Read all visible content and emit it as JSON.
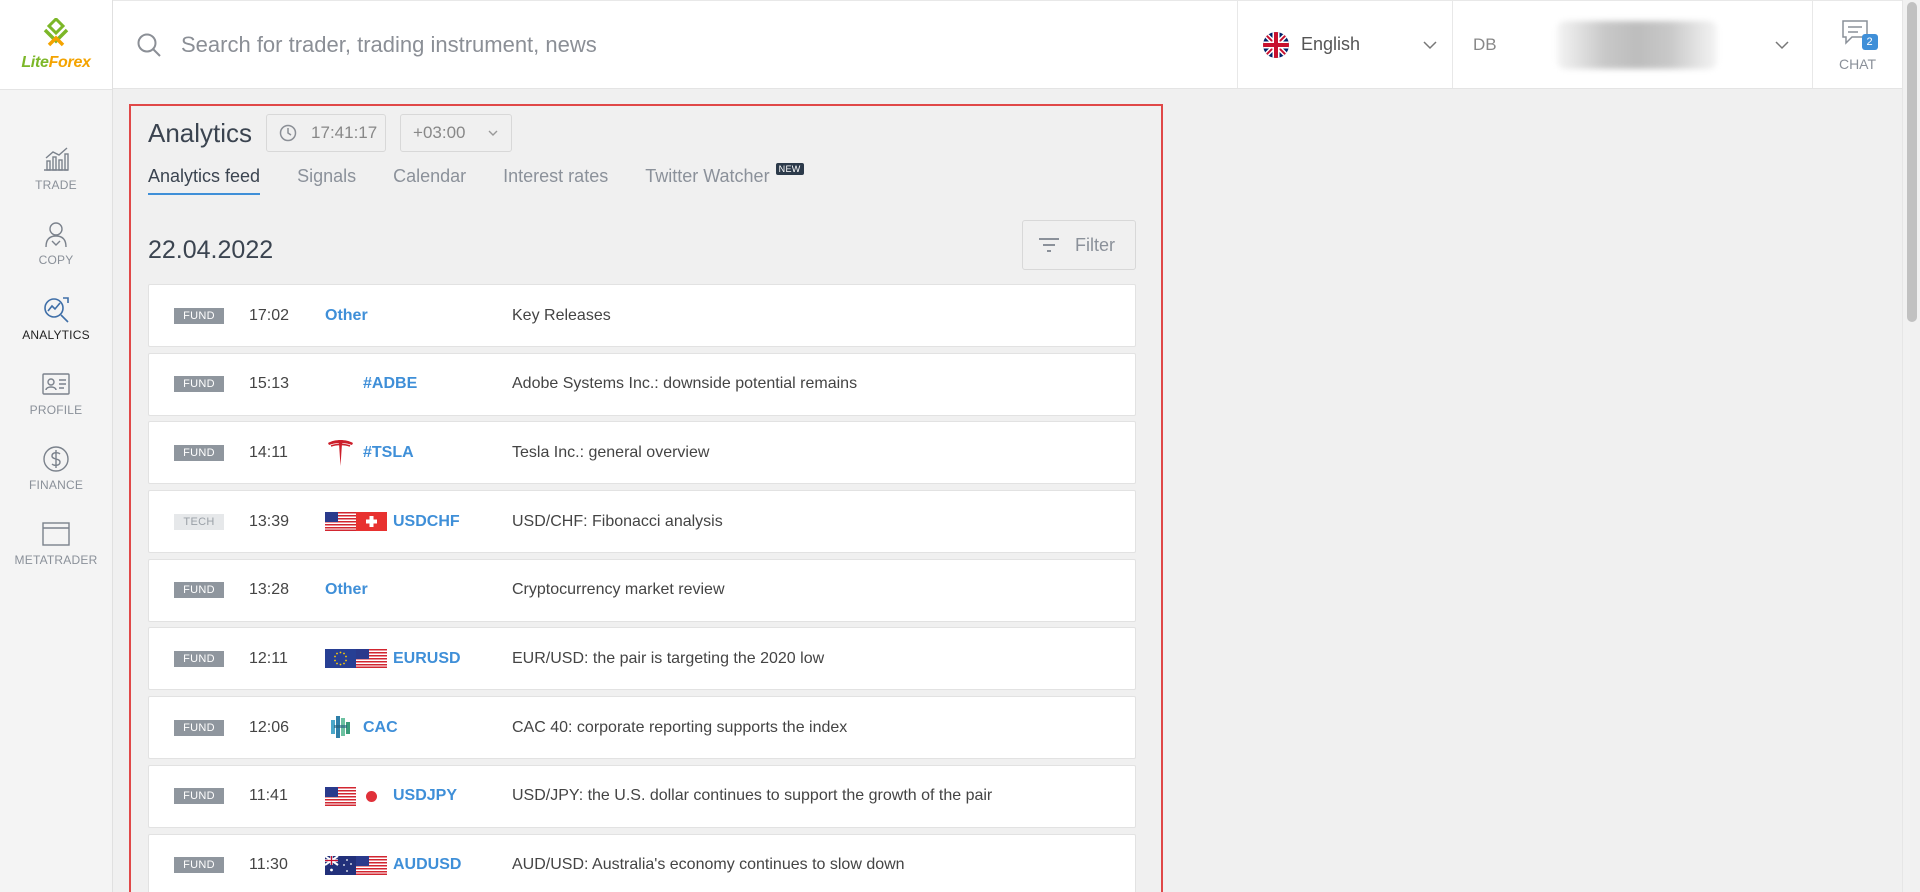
{
  "brand": {
    "name_left": "Lite",
    "name_right": "Forex",
    "accent": "#7cb728",
    "accent2": "#f4a300"
  },
  "sidebar": {
    "items": [
      {
        "label": "TRADE",
        "icon": "trade-chart-icon"
      },
      {
        "label": "COPY",
        "icon": "copy-trader-icon"
      },
      {
        "label": "ANALYTICS",
        "icon": "analytics-icon"
      },
      {
        "label": "PROFILE",
        "icon": "profile-card-icon"
      },
      {
        "label": "FINANCE",
        "icon": "dollar-coin-icon"
      },
      {
        "label": "METATRADER",
        "icon": "window-icon"
      }
    ],
    "active": "ANALYTICS"
  },
  "header": {
    "search_placeholder": "Search for trader, trading instrument, news",
    "language": "English",
    "account_prefix": "DB",
    "chat_label": "CHAT",
    "chat_count": "2"
  },
  "analytics": {
    "title": "Analytics",
    "clock": "17:41:17",
    "timezone": "+03:00",
    "tabs": [
      {
        "label": "Analytics feed",
        "active": true
      },
      {
        "label": "Signals"
      },
      {
        "label": "Calendar"
      },
      {
        "label": "Interest rates"
      },
      {
        "label": "Twitter Watcher",
        "badge": "NEW"
      }
    ],
    "date": "22.04.2022",
    "filter_label": "Filter",
    "rows": [
      {
        "type": "FUND",
        "time": "17:02",
        "symbol": "Other",
        "title": "Key Releases",
        "icon": "none"
      },
      {
        "type": "FUND",
        "time": "15:13",
        "symbol": "#ADBE",
        "title": "Adobe Systems Inc.: downside potential remains",
        "icon": "blank"
      },
      {
        "type": "FUND",
        "time": "14:11",
        "symbol": "#TSLA",
        "title": "Tesla Inc.: general overview",
        "icon": "tesla-logo-icon"
      },
      {
        "type": "TECH",
        "time": "13:39",
        "symbol": "USDCHF",
        "title": "USD/CHF: Fibonacci analysis",
        "icon": "flags-usd-chf"
      },
      {
        "type": "FUND",
        "time": "13:28",
        "symbol": "Other",
        "title": "Cryptocurrency market review",
        "icon": "none"
      },
      {
        "type": "FUND",
        "time": "12:11",
        "symbol": "EURUSD",
        "title": "EUR/USD: the pair is targeting the 2020 low",
        "icon": "flags-eur-usd"
      },
      {
        "type": "FUND",
        "time": "12:06",
        "symbol": "CAC",
        "title": "CAC 40: corporate reporting supports the index",
        "icon": "cac-logo-icon"
      },
      {
        "type": "FUND",
        "time": "11:41",
        "symbol": "USDJPY",
        "title": "USD/JPY: the U.S. dollar continues to support the growth of the pair",
        "icon": "flags-usd-jpy"
      },
      {
        "type": "FUND",
        "time": "11:30",
        "symbol": "AUDUSD",
        "title": "AUD/USD: Australia's economy continues to slow down",
        "icon": "flags-aud-usd"
      }
    ]
  }
}
